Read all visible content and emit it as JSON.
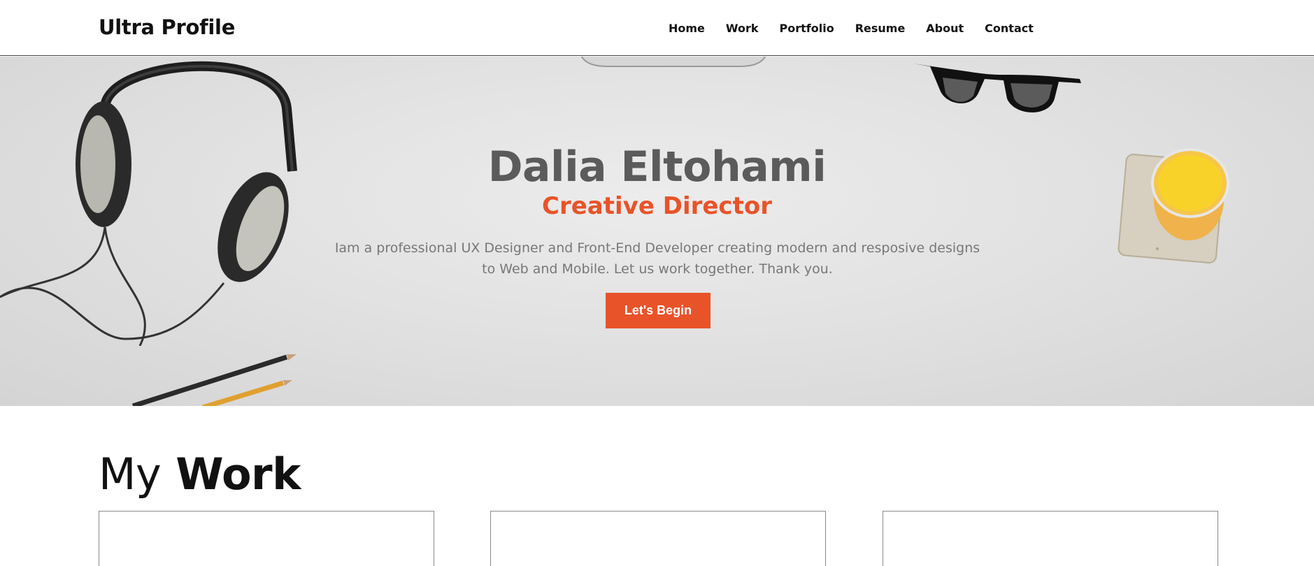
{
  "header": {
    "brand": "Ultra Profile",
    "nav": [
      "Home",
      "Work",
      "Portfolio",
      "Resume",
      "About",
      "Contact"
    ]
  },
  "hero": {
    "name": "Dalia Eltohami",
    "role": "Creative Director",
    "description": "Iam a professional UX Designer and Front-End Developer creating modern and resposive designs to Web and Mobile. Let us work together. Thank you.",
    "button_label": "Let's Begin",
    "decorations": [
      "headphones-image",
      "pencils-image",
      "glasses-image",
      "juice-glass-image",
      "laptop-edge-image"
    ]
  },
  "section": {
    "title_light": "My",
    "title_bold": "Work"
  },
  "cards": [
    {},
    {},
    {}
  ],
  "colors": {
    "accent": "#e8532a",
    "name_text": "#5b5b5b",
    "desc_text": "#777777"
  }
}
